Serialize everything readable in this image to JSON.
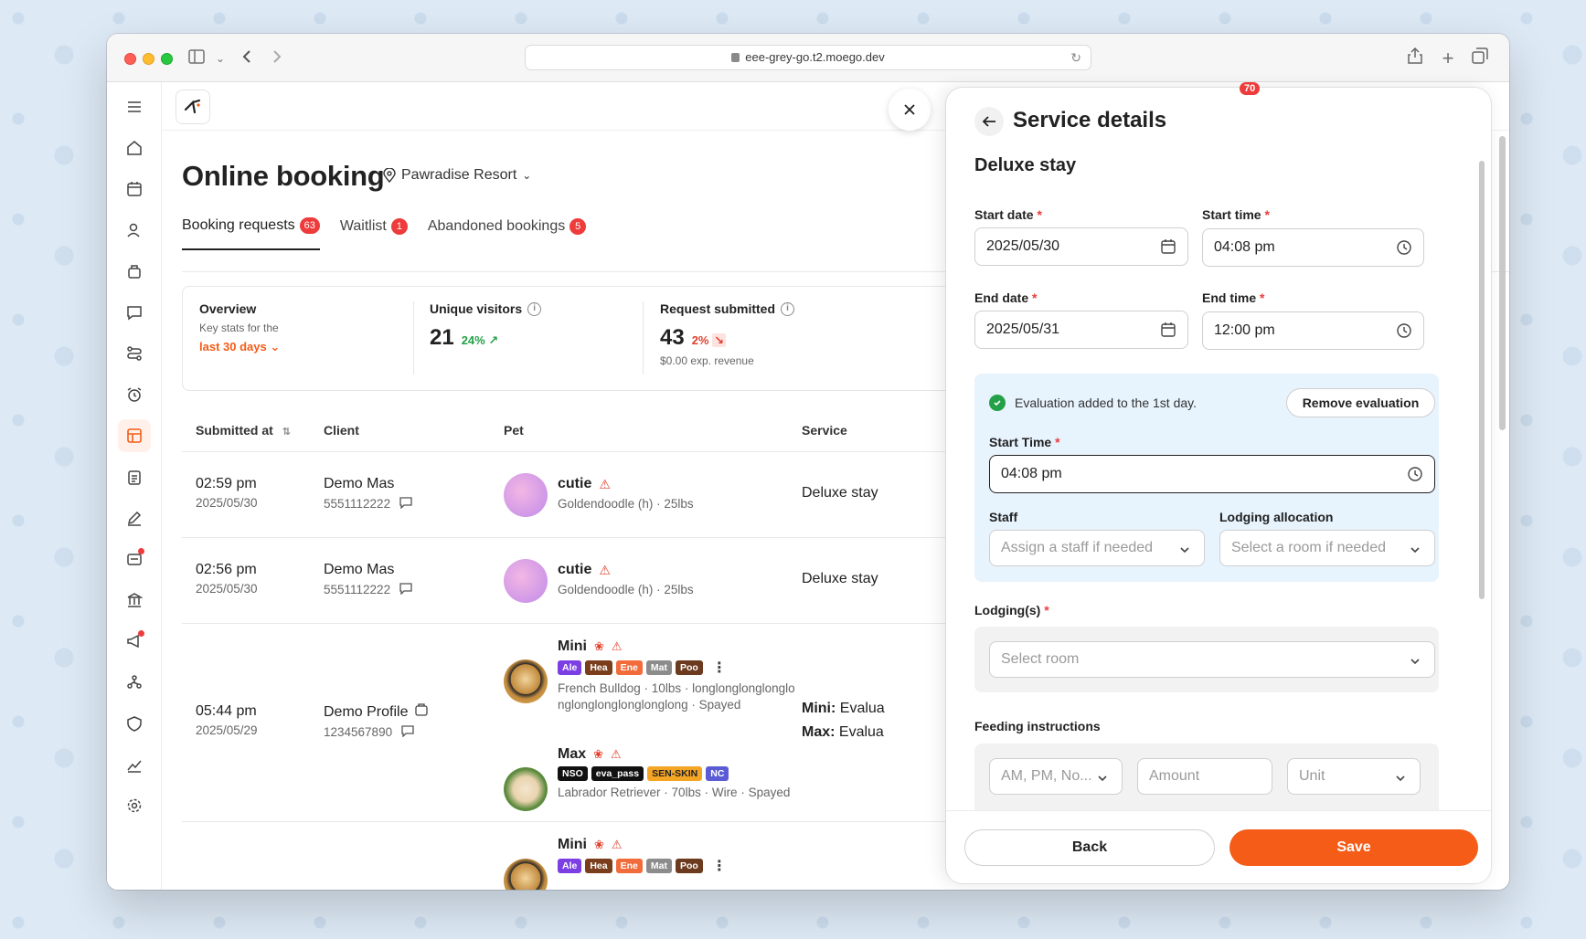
{
  "browser": {
    "url": "eee-grey-go.t2.moego.dev"
  },
  "page": {
    "title": "Online booking",
    "location": "Pawradise Resort",
    "notification_count": "70"
  },
  "tabs": [
    {
      "label": "Booking requests",
      "count": "63"
    },
    {
      "label": "Waitlist",
      "count": "1"
    },
    {
      "label": "Abandoned bookings",
      "count": "5"
    }
  ],
  "stats": {
    "overview_title": "Overview",
    "overview_sub": "Key stats for the",
    "overview_period": "last 30 days",
    "visitors_title": "Unique visitors",
    "visitors_value": "21",
    "visitors_change": "24%",
    "requests_title": "Request submitted",
    "requests_value": "43",
    "requests_change": "2%",
    "requests_revenue": "$0.00 exp. revenue"
  },
  "table": {
    "headers": {
      "submitted": "Submitted at",
      "client": "Client",
      "pet": "Pet",
      "service": "Service"
    },
    "rows": [
      {
        "time": "02:59 pm",
        "date": "2025/05/30",
        "client": "Demo Mas",
        "phone": "5551112222",
        "pet_name": "cutie",
        "pet_desc": "Goldendoodle (h) · 25lbs",
        "service": "Deluxe stay"
      },
      {
        "time": "02:56 pm",
        "date": "2025/05/30",
        "client": "Demo Mas",
        "phone": "5551112222",
        "pet_name": "cutie",
        "pet_desc": "Goldendoodle (h) · 25lbs",
        "service": "Deluxe stay"
      },
      {
        "time": "05:44 pm",
        "date": "2025/05/29",
        "client": "Demo Profile",
        "phone": "1234567890",
        "pet1_name": "Mini",
        "pet1_tags": [
          "Ale",
          "Hea",
          "Ene",
          "Mat",
          "Poo"
        ],
        "pet1_desc": "French Bulldog · 10lbs · longlonglonglonglonglonglonglonglonglong · Spayed",
        "pet2_name": "Max",
        "pet2_tags": [
          "NSO",
          "eva_pass",
          "SEN-SKIN",
          "NC"
        ],
        "pet2_desc": "Labrador Retriever · 70lbs · Wire · Spayed",
        "service1_pet": "Mini:",
        "service1": "Evalua",
        "service2_pet": "Max:",
        "service2": "Evalua"
      },
      {
        "pet1_name": "Mini",
        "pet1_tags": [
          "Ale",
          "Hea",
          "Ene",
          "Mat",
          "Poo"
        ]
      }
    ]
  },
  "drawer": {
    "title": "Service details",
    "subtitle": "Deluxe stay",
    "start_date_label": "Start date",
    "start_date": "2025/05/30",
    "start_time_label": "Start time",
    "start_time": "04:08 pm",
    "end_date_label": "End date",
    "end_date": "2025/05/31",
    "end_time_label": "End time",
    "end_time": "12:00 pm",
    "evaluation_text": "Evaluation added to the 1st day.",
    "remove_eval_label": "Remove evaluation",
    "eval_start_time_label": "Start Time",
    "eval_start_time": "04:08 pm",
    "staff_label": "Staff",
    "staff_placeholder": "Assign a staff if needed",
    "lodging_alloc_label": "Lodging allocation",
    "lodging_alloc_placeholder": "Select a room if needed",
    "lodgings_label": "Lodging(s)",
    "lodging_placeholder": "Select room",
    "feeding_label": "Feeding instructions",
    "feeding_schedule_placeholder": "AM, PM, No...",
    "feeding_amount_placeholder": "Amount",
    "feeding_unit_placeholder": "Unit",
    "back_label": "Back",
    "save_label": "Save"
  },
  "colors": {
    "accent": "#f45c17",
    "badge": "#ee3b3b",
    "eval_bg": "#e7f3fd",
    "success": "#24a148",
    "tag_ale": "#7b3fe4",
    "tag_hea": "#7a3e1d",
    "tag_ene": "#f26b3a",
    "tag_mat": "#8c8c8c",
    "tag_poo": "#6b3a1f",
    "tag_nso": "#111111",
    "tag_eva_pass": "#111111",
    "tag_sen_skin": "#f5a524",
    "tag_nc": "#5b5bd6"
  }
}
